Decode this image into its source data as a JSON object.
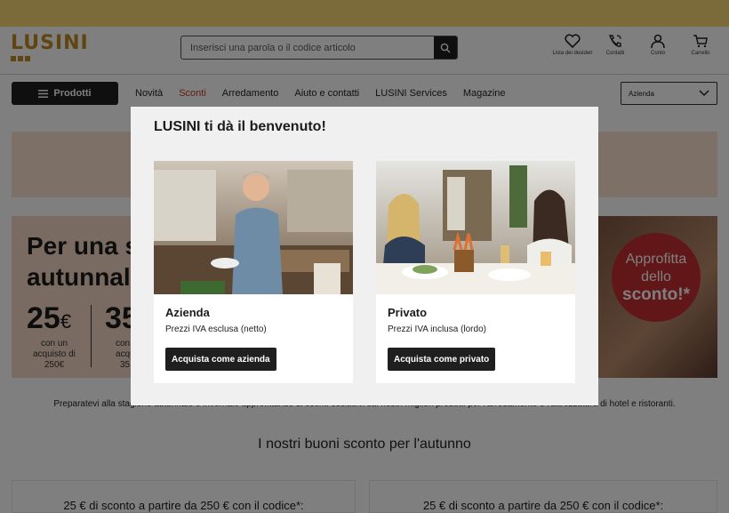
{
  "header": {
    "logo_text": "LUSINI",
    "search_placeholder": "Inserisci una parola o il codice articolo",
    "icons": [
      {
        "name": "heart-icon",
        "label": "Lista dei desideri"
      },
      {
        "name": "phone-icon",
        "label": "Contatti"
      },
      {
        "name": "user-icon",
        "label": "Conto"
      },
      {
        "name": "cart-icon",
        "label": "Carrello"
      }
    ]
  },
  "nav": {
    "products_label": "Prodotti",
    "links": [
      "Novità",
      "Sconti",
      "Arredamento",
      "Aiuto e contatti",
      "LUSINI Services",
      "Magazine"
    ],
    "accent_link_index": 1,
    "customer_type": "Azienda"
  },
  "page": {
    "hero_title_line1": "Per una s",
    "hero_title_line2": "autunnale",
    "hero_amount1": "25",
    "hero_currency": "€",
    "hero_amount2": "35",
    "hero_sub": "con un acquisto di 250€",
    "hero_sub2a": "con",
    "hero_sub2b": "acquis",
    "hero_sub2c": "35",
    "badge_line1": "Approfitta",
    "badge_line2": "dello",
    "badge_line3": "sconto!*",
    "prepara_text": "Preparatevi alla stagione autunnale e invernale approfittando di sconti esclusivi sui nostri migliori prodotti per l'arredamento e l'attrezzatura di hotel e ristoranti.",
    "section_title": "I nostri buoni sconto per l'autunno",
    "coupon1": "25 € di sconto a partire da 250 € con il codice*:",
    "coupon2": "25 € di sconto a partire da 250 € con il codice*:"
  },
  "modal": {
    "title": "LUSINI ti dà il benvenuto!",
    "cards": [
      {
        "title": "Azienda",
        "subtitle": "Prezzi IVA esclusa (netto)",
        "button": "Acquista come azienda"
      },
      {
        "title": "Privato",
        "subtitle": "Prezzi IVA inclusa (lordo)",
        "button": "Acquista come privato"
      }
    ]
  },
  "colors": {
    "brand": "#c08b20",
    "dark": "#1f1f1f",
    "accent": "#c0392b",
    "badge": "#c22e2e"
  }
}
